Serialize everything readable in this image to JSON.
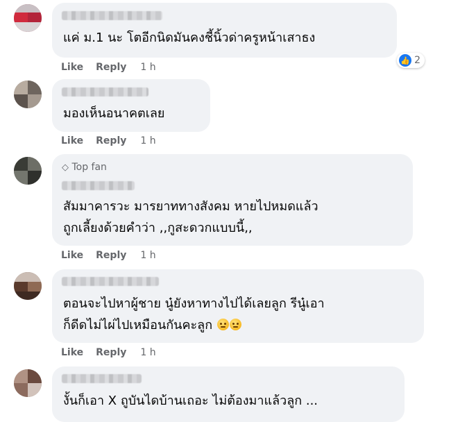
{
  "comments": [
    {
      "text_lines": [
        "แค่ ม.1 นะ โตอีกนิดมันคงชี้นิ้วด่าครูหน้าเสาธง"
      ],
      "reaction_count": "2",
      "like": "Like",
      "reply": "Reply",
      "time": "1 h"
    },
    {
      "text_lines": [
        "มองเห็นอนาคตเลย"
      ],
      "like": "Like",
      "reply": "Reply",
      "time": "1 h"
    },
    {
      "badge": "Top fan",
      "text_lines": [
        "สัมมาคารวะ มารยาททางสังคม หายไปหมดแล้ว",
        "ถูกเลี้ยงด้วยคำว่า ,,กูสะดวกแบบนี้,,"
      ],
      "like": "Like",
      "reply": "Reply",
      "time": "1 h"
    },
    {
      "text_lines": [
        "ตอนจะไปหาผู้ชาย นู๋ยังหาทางไปได้เลยลูก รีนู๋เอา",
        "ก็ดีดไม่ไผ่ไปเหมือนกันคะลูก"
      ],
      "emoji": [
        "sad-emoji",
        "sad-emoji"
      ],
      "like": "Like",
      "reply": "Reply",
      "time": "1 h"
    },
    {
      "text_lines": [
        "งั้นก็เอา X ถูบันไดบ้านเถอะ ไม่ต้องมาแล้วลูก ..."
      ]
    }
  ],
  "icons": {
    "like": "thumbs-up-icon",
    "badge": "diamond-icon"
  },
  "colors": {
    "bubble": "#f0f2f5",
    "meta": "#65676b",
    "like_blue": "#1877f2"
  }
}
